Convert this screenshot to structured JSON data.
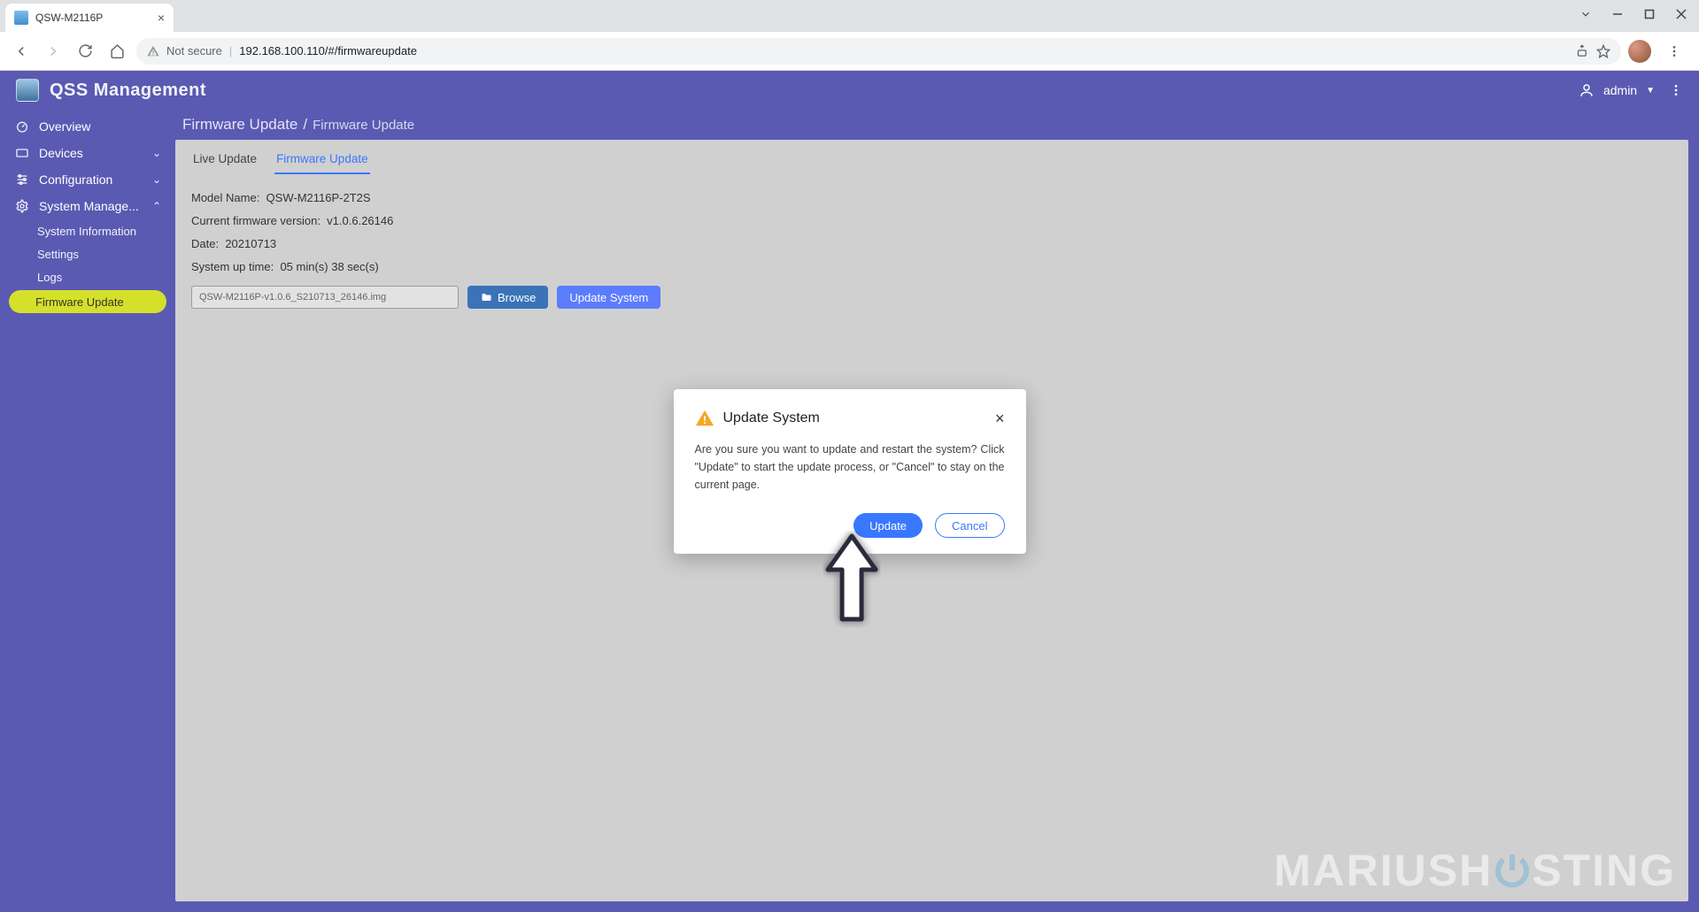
{
  "browser": {
    "tab_title": "QSW-M2116P",
    "security_label": "Not secure",
    "url": "192.168.100.110/#/firmwareupdate"
  },
  "header": {
    "app_title": "QSS Management",
    "user_label": "admin"
  },
  "sidebar": {
    "items": [
      {
        "label": "Overview"
      },
      {
        "label": "Devices"
      },
      {
        "label": "Configuration"
      },
      {
        "label": "System Manage..."
      }
    ],
    "sub_items": [
      {
        "label": "System Information"
      },
      {
        "label": "Settings"
      },
      {
        "label": "Logs"
      },
      {
        "label": "Firmware Update"
      }
    ]
  },
  "breadcrumb": {
    "root": "Firmware Update",
    "current": "Firmware Update"
  },
  "tabs": {
    "live": "Live Update",
    "fw": "Firmware Update"
  },
  "fw": {
    "model_label": "Model Name:",
    "model_value": "QSW-M2116P-2T2S",
    "version_label": "Current firmware version:",
    "version_value": "v1.0.6.26146",
    "date_label": "Date:",
    "date_value": "20210713",
    "uptime_label": "System up time:",
    "uptime_value": "05 min(s) 38 sec(s)",
    "file_value": "QSW-M2116P-v1.0.6_S210713_26146.img",
    "browse_label": "Browse",
    "update_system_label": "Update System"
  },
  "modal": {
    "title": "Update System",
    "body": "Are you sure you want to update and restart the system? Click \"Update\" to start the update process, or \"Cancel\" to stay on the current page.",
    "update_label": "Update",
    "cancel_label": "Cancel"
  },
  "watermark": {
    "part1": "MARIUSH",
    "part2": "STING"
  }
}
